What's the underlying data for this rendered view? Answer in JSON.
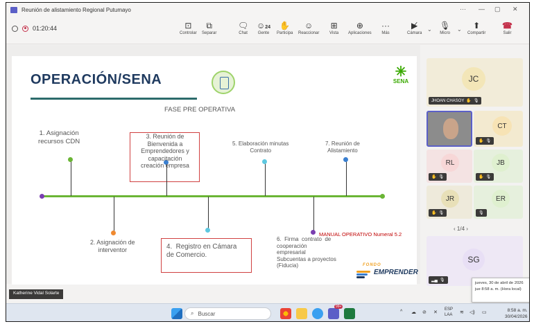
{
  "window": {
    "title": "Reunión de alistamiento Regional Putumayo",
    "controls": [
      "···",
      "—",
      "▢",
      "✕"
    ]
  },
  "toolbar": {
    "timer": "01:20:44",
    "people_count": "24",
    "buttons": [
      {
        "label": "Controlar",
        "icon": "share-tray-icon"
      },
      {
        "label": "Separar",
        "icon": "pop-out-icon"
      },
      {
        "label": "Chat",
        "icon": "chat-icon"
      },
      {
        "label": "Gente",
        "icon": "people-icon"
      },
      {
        "label": "Participa",
        "icon": "raise-hand-icon"
      },
      {
        "label": "Reaccionar",
        "icon": "smiley-icon"
      },
      {
        "label": "Vista",
        "icon": "grid-view-icon"
      },
      {
        "label": "Aplicaciones",
        "icon": "apps-icon"
      },
      {
        "label": "Más",
        "icon": "more-icon"
      },
      {
        "label": "Cámara",
        "icon": "camera-off-icon"
      },
      {
        "label": "Micro",
        "icon": "mic-off-icon"
      },
      {
        "label": "Compartir",
        "icon": "share-icon"
      },
      {
        "label": "Salir",
        "icon": "hang-up-icon"
      }
    ]
  },
  "slide": {
    "title": "OPERACIÓN/SENA",
    "subtitle": "FASE PRE OPERATIVA",
    "sena_logo": "SENA",
    "steps": {
      "s1": "1. Asignación\nrecursos CDN",
      "s2": "2. Asignación de\ninterventor",
      "s3": "3. Reunión de\nBienvenida a\nEmprendedores y\ncapacitación\ncreación empresa",
      "s4": "4.  Registro en Cámara\nde Comercio.",
      "s5": "5. Elaboración minutas\nContrato",
      "s6": "6.  Firma  contrato  de\ncooperación\nempresarial\nSubcuentas a proyectos\n(Fiducia)",
      "s7": "7. Reunión de\nAlistamiento"
    },
    "manual_note": "MANUAL OPERATIVO Numeral 5.2",
    "brand_small": "FONDO",
    "brand_name": "EMPRENDER"
  },
  "speaker_label": "Katherine Vidal Solarte",
  "participants": [
    {
      "initials": "JC",
      "name": "JHOAN CHASOY",
      "color": "#f3e6b8"
    },
    {
      "initials": "CT",
      "name": "",
      "color": "#f7e3b5"
    },
    {
      "initials": "RL",
      "name": "",
      "color": "#f7d7d7"
    },
    {
      "initials": "JB",
      "name": "",
      "color": "#dff0cf"
    },
    {
      "initials": "JR",
      "name": "",
      "color": "#e8e0b8"
    },
    {
      "initials": "ER",
      "name": "",
      "color": "#dff0cf"
    },
    {
      "initials": "SG",
      "name": "",
      "color": "#e8dff5"
    }
  ],
  "pager": "1/4",
  "tooltip": {
    "line1": "jueves, 30 de abril de 2026",
    "line2": "jue 8:58 a. m. (Hora local)"
  },
  "taskbar": {
    "search_placeholder": "Buscar",
    "lang_top": "ESP",
    "lang_bottom": "LAA",
    "time": "8:58 a. m.",
    "date": "30/04/2026",
    "notif_count": "99+"
  }
}
